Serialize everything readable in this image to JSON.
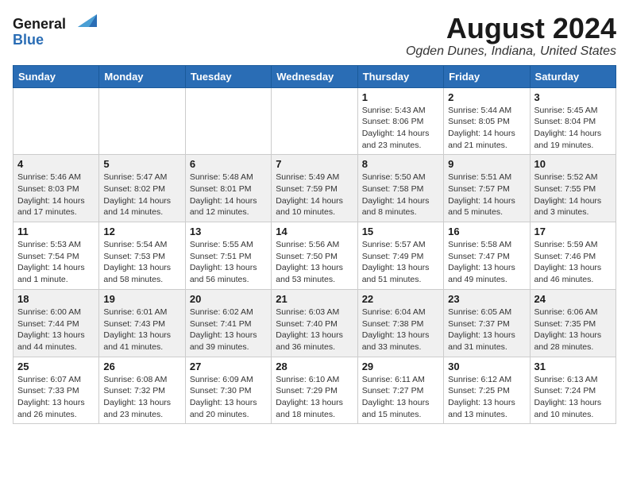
{
  "header": {
    "logo_general": "General",
    "logo_blue": "Blue",
    "month_title": "August 2024",
    "location": "Ogden Dunes, Indiana, United States"
  },
  "weekdays": [
    "Sunday",
    "Monday",
    "Tuesday",
    "Wednesday",
    "Thursday",
    "Friday",
    "Saturday"
  ],
  "weeks": [
    [
      {
        "day": "",
        "info": ""
      },
      {
        "day": "",
        "info": ""
      },
      {
        "day": "",
        "info": ""
      },
      {
        "day": "",
        "info": ""
      },
      {
        "day": "1",
        "info": "Sunrise: 5:43 AM\nSunset: 8:06 PM\nDaylight: 14 hours\nand 23 minutes."
      },
      {
        "day": "2",
        "info": "Sunrise: 5:44 AM\nSunset: 8:05 PM\nDaylight: 14 hours\nand 21 minutes."
      },
      {
        "day": "3",
        "info": "Sunrise: 5:45 AM\nSunset: 8:04 PM\nDaylight: 14 hours\nand 19 minutes."
      }
    ],
    [
      {
        "day": "4",
        "info": "Sunrise: 5:46 AM\nSunset: 8:03 PM\nDaylight: 14 hours\nand 17 minutes."
      },
      {
        "day": "5",
        "info": "Sunrise: 5:47 AM\nSunset: 8:02 PM\nDaylight: 14 hours\nand 14 minutes."
      },
      {
        "day": "6",
        "info": "Sunrise: 5:48 AM\nSunset: 8:01 PM\nDaylight: 14 hours\nand 12 minutes."
      },
      {
        "day": "7",
        "info": "Sunrise: 5:49 AM\nSunset: 7:59 PM\nDaylight: 14 hours\nand 10 minutes."
      },
      {
        "day": "8",
        "info": "Sunrise: 5:50 AM\nSunset: 7:58 PM\nDaylight: 14 hours\nand 8 minutes."
      },
      {
        "day": "9",
        "info": "Sunrise: 5:51 AM\nSunset: 7:57 PM\nDaylight: 14 hours\nand 5 minutes."
      },
      {
        "day": "10",
        "info": "Sunrise: 5:52 AM\nSunset: 7:55 PM\nDaylight: 14 hours\nand 3 minutes."
      }
    ],
    [
      {
        "day": "11",
        "info": "Sunrise: 5:53 AM\nSunset: 7:54 PM\nDaylight: 14 hours\nand 1 minute."
      },
      {
        "day": "12",
        "info": "Sunrise: 5:54 AM\nSunset: 7:53 PM\nDaylight: 13 hours\nand 58 minutes."
      },
      {
        "day": "13",
        "info": "Sunrise: 5:55 AM\nSunset: 7:51 PM\nDaylight: 13 hours\nand 56 minutes."
      },
      {
        "day": "14",
        "info": "Sunrise: 5:56 AM\nSunset: 7:50 PM\nDaylight: 13 hours\nand 53 minutes."
      },
      {
        "day": "15",
        "info": "Sunrise: 5:57 AM\nSunset: 7:49 PM\nDaylight: 13 hours\nand 51 minutes."
      },
      {
        "day": "16",
        "info": "Sunrise: 5:58 AM\nSunset: 7:47 PM\nDaylight: 13 hours\nand 49 minutes."
      },
      {
        "day": "17",
        "info": "Sunrise: 5:59 AM\nSunset: 7:46 PM\nDaylight: 13 hours\nand 46 minutes."
      }
    ],
    [
      {
        "day": "18",
        "info": "Sunrise: 6:00 AM\nSunset: 7:44 PM\nDaylight: 13 hours\nand 44 minutes."
      },
      {
        "day": "19",
        "info": "Sunrise: 6:01 AM\nSunset: 7:43 PM\nDaylight: 13 hours\nand 41 minutes."
      },
      {
        "day": "20",
        "info": "Sunrise: 6:02 AM\nSunset: 7:41 PM\nDaylight: 13 hours\nand 39 minutes."
      },
      {
        "day": "21",
        "info": "Sunrise: 6:03 AM\nSunset: 7:40 PM\nDaylight: 13 hours\nand 36 minutes."
      },
      {
        "day": "22",
        "info": "Sunrise: 6:04 AM\nSunset: 7:38 PM\nDaylight: 13 hours\nand 33 minutes."
      },
      {
        "day": "23",
        "info": "Sunrise: 6:05 AM\nSunset: 7:37 PM\nDaylight: 13 hours\nand 31 minutes."
      },
      {
        "day": "24",
        "info": "Sunrise: 6:06 AM\nSunset: 7:35 PM\nDaylight: 13 hours\nand 28 minutes."
      }
    ],
    [
      {
        "day": "25",
        "info": "Sunrise: 6:07 AM\nSunset: 7:33 PM\nDaylight: 13 hours\nand 26 minutes."
      },
      {
        "day": "26",
        "info": "Sunrise: 6:08 AM\nSunset: 7:32 PM\nDaylight: 13 hours\nand 23 minutes."
      },
      {
        "day": "27",
        "info": "Sunrise: 6:09 AM\nSunset: 7:30 PM\nDaylight: 13 hours\nand 20 minutes."
      },
      {
        "day": "28",
        "info": "Sunrise: 6:10 AM\nSunset: 7:29 PM\nDaylight: 13 hours\nand 18 minutes."
      },
      {
        "day": "29",
        "info": "Sunrise: 6:11 AM\nSunset: 7:27 PM\nDaylight: 13 hours\nand 15 minutes."
      },
      {
        "day": "30",
        "info": "Sunrise: 6:12 AM\nSunset: 7:25 PM\nDaylight: 13 hours\nand 13 minutes."
      },
      {
        "day": "31",
        "info": "Sunrise: 6:13 AM\nSunset: 7:24 PM\nDaylight: 13 hours\nand 10 minutes."
      }
    ]
  ]
}
